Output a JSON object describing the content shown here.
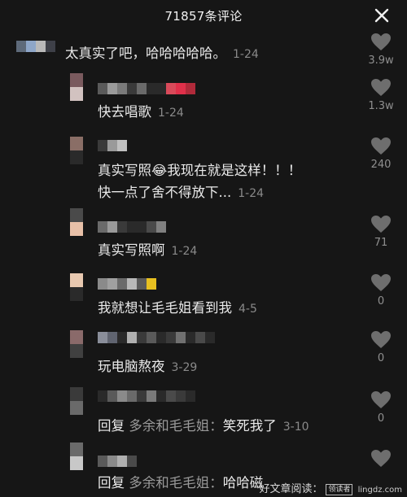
{
  "header": {
    "title": "71857条评论",
    "close_icon": "close-icon"
  },
  "comments": [
    {
      "text": "太真实了吧，哈哈哈哈哈。",
      "date": "1-24",
      "likes": "3.9w"
    },
    {
      "text": "快去唱歌",
      "date": "1-24",
      "likes": "1.3w"
    },
    {
      "text_line1_a": "真实写照",
      "emoji": "😂",
      "text_line1_b": "我现在就是这样！！！",
      "text_line2": "快一点了舍不得放下...",
      "date": "1-24",
      "likes": "240"
    },
    {
      "text": "真实写照啊",
      "date": "1-24",
      "likes": "71"
    },
    {
      "text": "我就想让毛毛姐看到我",
      "date": "4-5",
      "likes": "0"
    },
    {
      "text": "玩电脑熬夜",
      "date": "3-29",
      "likes": "0"
    },
    {
      "reply_prefix": "回复",
      "reply_to": "多余和毛毛姐：",
      "text": "笑死我了",
      "date": "3-10",
      "likes": "0"
    },
    {
      "reply_prefix": "回复",
      "reply_to": "多余和毛毛姐：",
      "text": "哈哈磁",
      "date": "",
      "likes": ""
    }
  ],
  "watermark": {
    "text": "好文章阅读：",
    "badge": "领读者",
    "site": "lingdz.com"
  },
  "colors": {
    "background": "#161616",
    "like_icon": "#6e6e6e",
    "date_text": "#8a8a8a"
  }
}
